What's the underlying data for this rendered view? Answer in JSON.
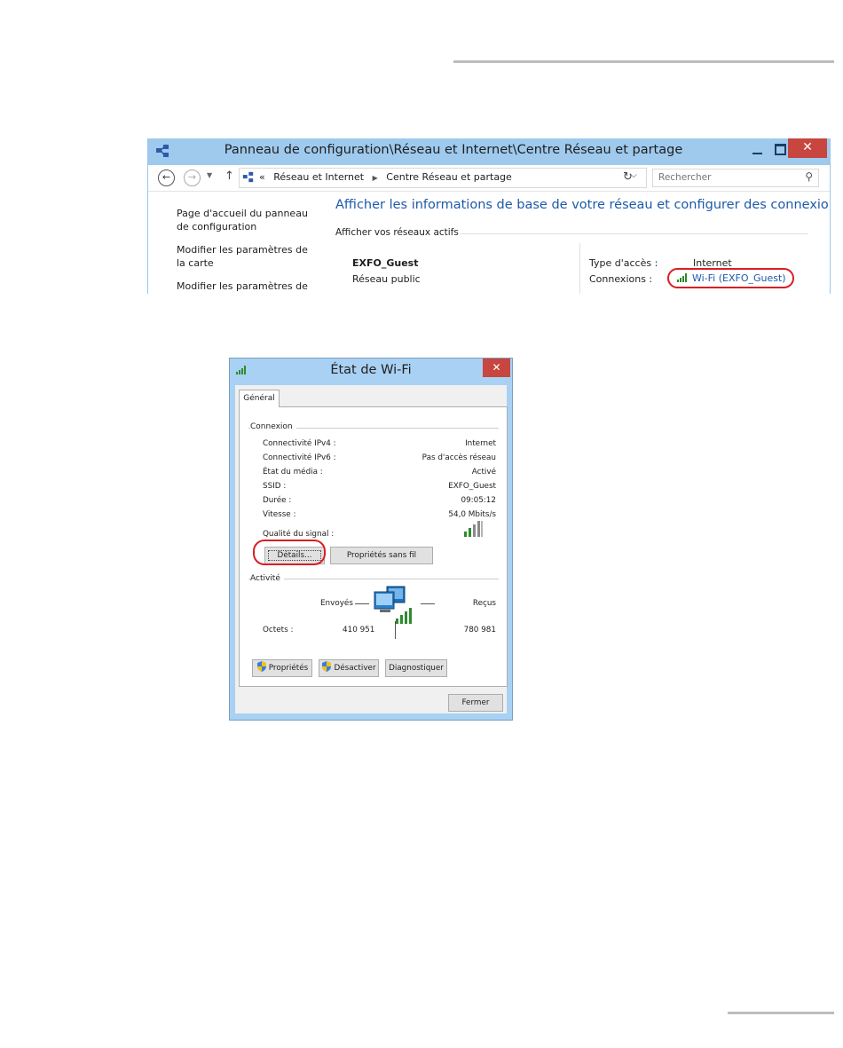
{
  "control_panel": {
    "title": "Panneau de configuration\\Réseau et Internet\\Centre Réseau et partage",
    "breadcrumb": {
      "prefix": "«",
      "items": [
        "Réseau et Internet",
        "Centre Réseau et partage"
      ]
    },
    "search_placeholder": "Rechercher",
    "left_links": [
      "Page d'accueil du panneau de configuration",
      "Modifier les paramètres de la carte",
      "Modifier les paramètres de"
    ],
    "heading": "Afficher les informations de base de votre réseau et configurer des connexions",
    "active_networks_label": "Afficher vos réseaux actifs",
    "network": {
      "name": "EXFO_Guest",
      "category": "Réseau public",
      "access_type_label": "Type d'accès :",
      "access_type_value": "Internet",
      "connections_label": "Connexions :",
      "connections_value": "Wi-Fi (EXFO_Guest)"
    }
  },
  "wifi_dialog": {
    "title": "État de Wi-Fi",
    "close_symbol": "✕",
    "tab": "Général",
    "connection_group": "Connexion",
    "rows": [
      {
        "label": "Connectivité IPv4 :",
        "value": "Internet"
      },
      {
        "label": "Connectivité IPv6 :",
        "value": "Pas d'accès réseau"
      },
      {
        "label": "État du média :",
        "value": "Activé"
      },
      {
        "label": "SSID :",
        "value": "EXFO_Guest"
      },
      {
        "label": "Durée :",
        "value": "09:05:12"
      },
      {
        "label": "Vitesse :",
        "value": "54,0 Mbits/s"
      }
    ],
    "signal_quality_label": "Qualité du signal :",
    "buttons": {
      "details": "Détails...",
      "wireless_properties": "Propriétés sans fil",
      "properties": "Propriétés",
      "disable": "Désactiver",
      "diagnose": "Diagnostiquer",
      "close": "Fermer"
    },
    "activity": {
      "group": "Activité",
      "sent_label": "Envoyés",
      "received_label": "Reçus",
      "bytes_label": "Octets :",
      "bytes_sent": "410 951",
      "bytes_received": "780 981"
    }
  },
  "colors": {
    "title_bar": "#9fcaee",
    "close_button": "#c7463f",
    "link_blue": "#1e5aa8",
    "highlight_red": "#d71f26",
    "signal_green": "#2e8b2e"
  },
  "icons": {
    "network_center": "network-center-icon",
    "signal": "signal-bars-icon",
    "shield": "uac-shield-icon",
    "computer": "network-computer-icon"
  }
}
